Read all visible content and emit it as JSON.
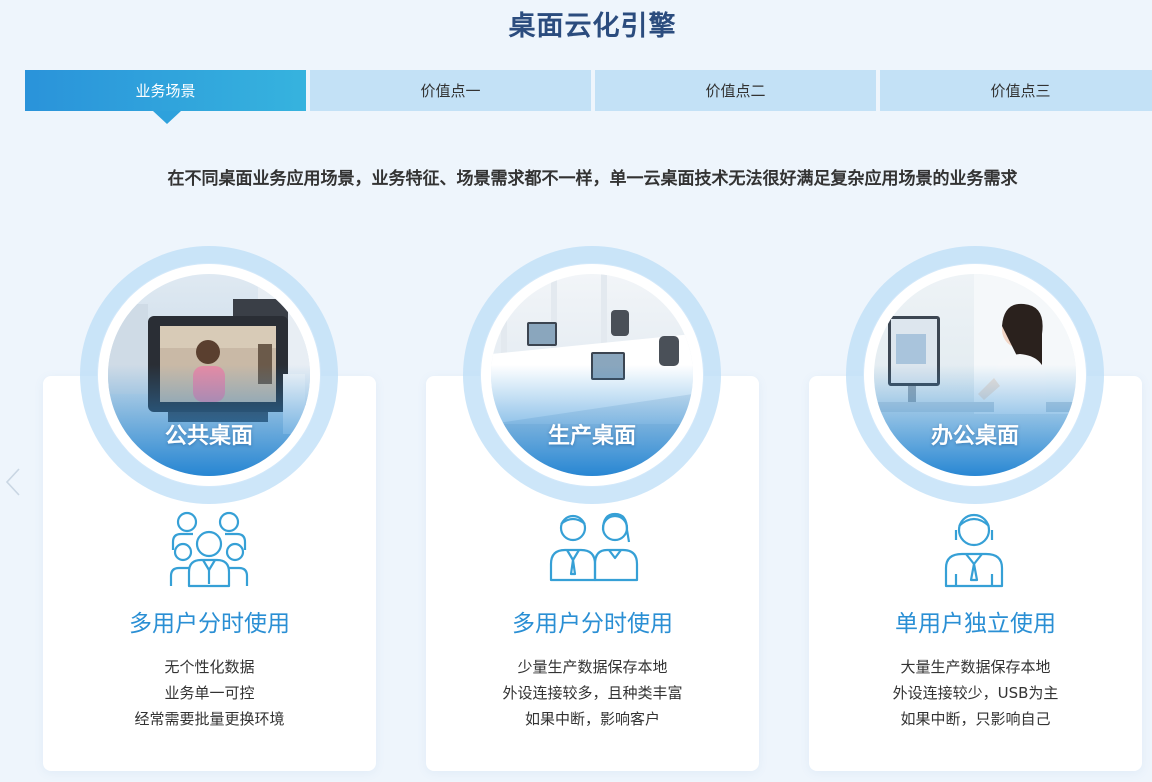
{
  "page_title": "桌面云化引擎",
  "tabs": [
    {
      "label": "业务场景",
      "active": true
    },
    {
      "label": "价值点一",
      "active": false
    },
    {
      "label": "价值点二",
      "active": false
    },
    {
      "label": "价值点三",
      "active": false
    }
  ],
  "subtitle": "在不同桌面业务应用场景，业务特征、场景需求都不一样，单一云桌面技术无法很好满足复杂应用场景的业务需求",
  "cards": [
    {
      "photo_label": "公共桌面",
      "icon": "user-group-icon",
      "usage_title": "多用户分时使用",
      "lines": [
        "无个性化数据",
        "业务单一可控",
        "经常需要批量更换环境"
      ]
    },
    {
      "photo_label": "生产桌面",
      "icon": "two-users-icon",
      "usage_title": "多用户分时使用",
      "lines": [
        "少量生产数据保存本地",
        "外设连接较多，且种类丰富",
        "如果中断，影响客户"
      ]
    },
    {
      "photo_label": "办公桌面",
      "icon": "single-user-icon",
      "usage_title": "单用户独立使用",
      "lines": [
        "大量生产数据保存本地",
        "外设连接较少，USB为主",
        "如果中断，只影响自己"
      ]
    }
  ],
  "colors": {
    "accent": "#2a8fd4",
    "tab_active": "#2a93da",
    "tab_inactive": "#c3e1f6",
    "page_bg": "#eef5fc",
    "title": "#2b4c7e"
  }
}
